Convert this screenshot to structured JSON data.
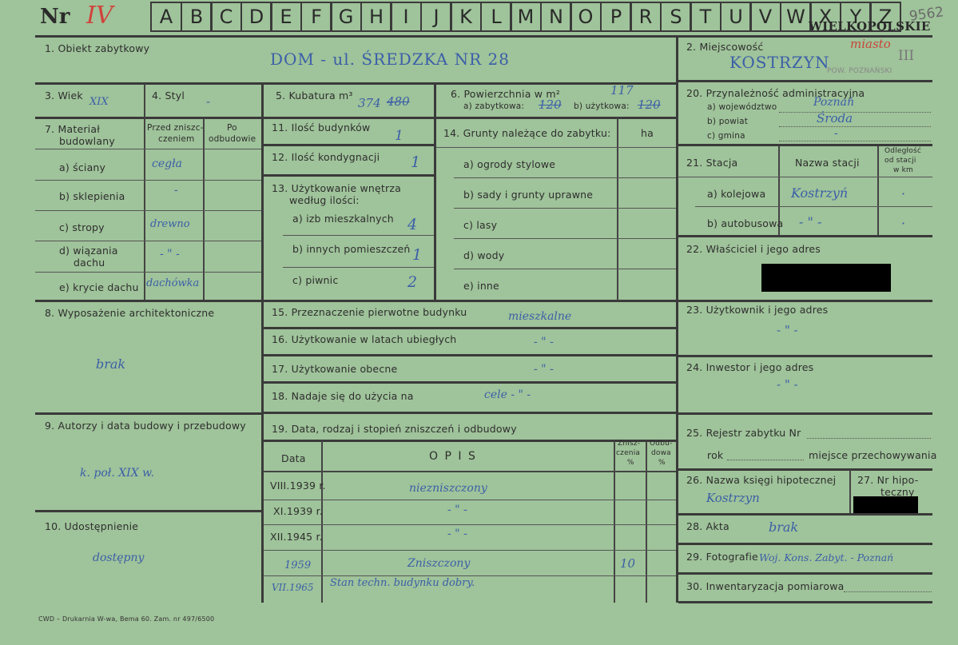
{
  "header": {
    "nr_label": "Nr",
    "nr_value": "IV",
    "letters": [
      "A",
      "B",
      "C",
      "D",
      "E",
      "F",
      "G",
      "H",
      "I",
      "J",
      "K",
      "L",
      "M",
      "N",
      "O",
      "P",
      "R",
      "S",
      "T",
      "U",
      "V",
      "W",
      "X",
      "Y",
      "Z"
    ],
    "region": "WIELKOPOLSKIE",
    "stamp_number": "9562"
  },
  "fields": {
    "f1_label": "1. Obiekt zabytkowy",
    "f1_value": "DOM - ul. ŚREDZKA NR 28",
    "f2_label": "2. Miejscowość",
    "f2_value": "KOSTRZYN",
    "f2_note": "miasto",
    "f2_extra": "III",
    "f2_sub": "POW. POZNAŃSKI",
    "f3_label": "3. Wiek",
    "f3_value": "XIX",
    "f4_label": "4. Styl",
    "f4_value": "-",
    "f5_label": "5. Kubatura m³",
    "f5_value": "374",
    "f5_struck": "480",
    "f6_label": "6. Powierzchnia w m²",
    "f6_total": "117",
    "f6_a_label": "a) zabytkowa:",
    "f6_a_value": "120",
    "f6_b_label": "b) użytkowa:",
    "f6_b_value": "120",
    "f20_label": "20. Przynależność administracyjna",
    "f20_a_label": "a) województwo",
    "f20_a_value": "Poznań",
    "f20_b_label": "b) powiat",
    "f20_b_value": "Środa",
    "f20_c_label": "c) gmina",
    "f20_c_value": "-",
    "f7_label1": "7. Materiał",
    "f7_label2": "budowlany",
    "f7_col1a": "Przed zniszc-",
    "f7_col1b": "czeniem",
    "f7_col2a": "Po",
    "f7_col2b": "odbudowie",
    "f7_rows": [
      {
        "label": "a) ściany",
        "value": "cegła"
      },
      {
        "label": "b) sklepienia",
        "value": "-"
      },
      {
        "label": "c) stropy",
        "value": "drewno"
      },
      {
        "label1": "d) wiązania",
        "label2": "dachu",
        "value": "- \" -"
      },
      {
        "label": "e) krycie dachu",
        "value": "dachówka"
      }
    ],
    "f11_label": "11. Ilość budynków",
    "f11_value": "1",
    "f12_label": "12. Ilość kondygnacji",
    "f12_value": "1",
    "f13_label1": "13. Użytkowanie wnętrza",
    "f13_label2": "według ilości:",
    "f13_a_label": "a) izb mieszkalnych",
    "f13_a_value": "4",
    "f13_b_label": "b) innych pomieszczeń",
    "f13_b_value": "1",
    "f13_c_label": "c) piwnic",
    "f13_c_value": "2",
    "f14_label": "14. Grunty należące do zabytku:",
    "f14_unit": "ha",
    "f14_rows": [
      "a) ogrody stylowe",
      "b) sady i grunty uprawne",
      "c) lasy",
      "d) wody",
      "e) inne"
    ],
    "f21_label": "21. Stacja",
    "f21_col1": "Nazwa stacji",
    "f21_col2a": "Odległość",
    "f21_col2b": "od stacji",
    "f21_col2c": "w km",
    "f21_a_label": "a) kolejowa",
    "f21_a_value": "Kostrzyń",
    "f21_a_km": "·",
    "f21_b_label": "b) autobusowa",
    "f21_b_value": "- \" -",
    "f21_b_km": "·",
    "f22_label": "22. Właściciel i jego adres",
    "f8_label": "8. Wyposażenie architektoniczne",
    "f8_value": "brak",
    "f15_label": "15. Przeznaczenie pierwotne budynku",
    "f15_value": "mieszkalne",
    "f16_label": "16. Użytkowanie w latach ubiegłych",
    "f16_value": "- \" -",
    "f17_label": "17. Użytkowanie obecne",
    "f17_value": "- \" -",
    "f18_label": "18. Nadaje się do użycia na",
    "f18_value": "cele - \" -",
    "f23_label": "23. Użytkownik i jego adres",
    "f23_value": "- \" -",
    "f24_label": "24. Inwestor i jego adres",
    "f24_value": "- \" -",
    "f9_label": "9. Autorzy i data budowy i przebudowy",
    "f9_value": "k. poł. XIX w.",
    "f19_label": "19. Data, rodzaj i stopień zniszczeń i odbudowy",
    "f19_col_data": "Data",
    "f19_col_opis": "O P I S",
    "f19_col_zn1": "Znisz-",
    "f19_col_zn2": "czenia",
    "f19_col_zn3": "%",
    "f19_col_od1": "Odbu-",
    "f19_col_od2": "dowa",
    "f19_col_od3": "%",
    "f19_rows": [
      {
        "date": "VIII.1939 r.",
        "opis": "niezniszczony",
        "zn": ""
      },
      {
        "date": "XI.1939 r.",
        "opis": "- \" -",
        "zn": ""
      },
      {
        "date": "XII.1945 r.",
        "opis": "- \" -",
        "zn": ""
      },
      {
        "date": "1959",
        "opis": "Zniszczony",
        "zn": "10"
      },
      {
        "date": "VII.1965",
        "opis": "Stan techn. budynku dobry.",
        "zn": ""
      }
    ],
    "f25_label": "25. Rejestr zabytku Nr",
    "f25_rok": "rok",
    "f25_miejsce": "miejsce przechowywania",
    "f26_label": "26. Nazwa księgi hipotecznej",
    "f26_value": "Kostrzyn",
    "f27_label1": "27. Nr hipo-",
    "f27_label2": "teczny",
    "f28_label": "28. Akta",
    "f28_value": "brak",
    "f29_label": "29. Fotografie",
    "f29_value": "Woj. Kons. Zabyt. - Poznań",
    "f30_label": "30. Inwentaryzacja pomiarowa",
    "f10_label": "10. Udostępnienie",
    "f10_value": "dostępny"
  },
  "footer": "CWD – Drukarnia W-wa, Bema 60. Zam. nr 497/6500"
}
